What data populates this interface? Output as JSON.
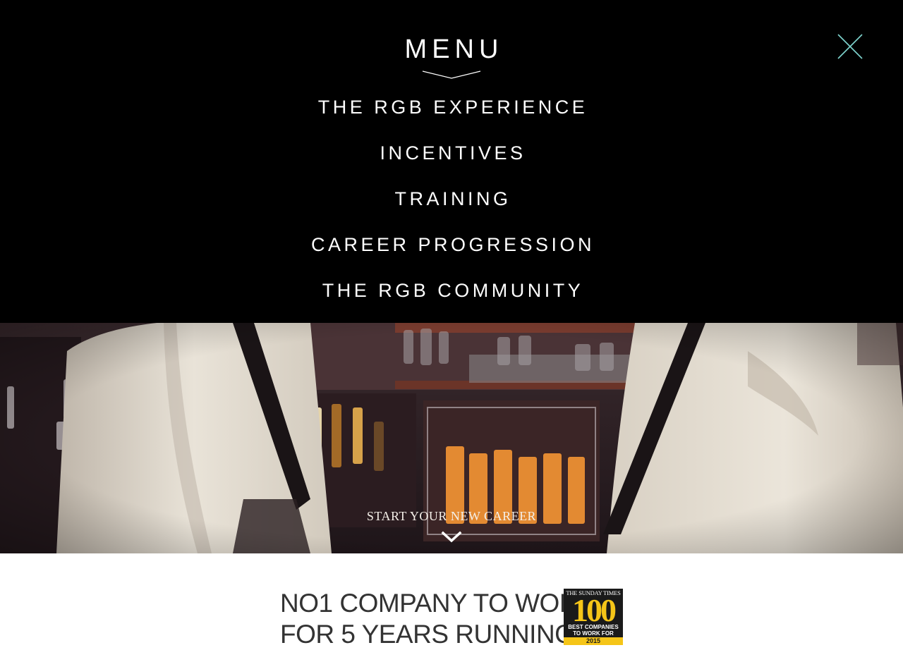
{
  "menu": {
    "title": "MENU",
    "items": [
      {
        "label": "THE RGB EXPERIENCE"
      },
      {
        "label": "INCENTIVES"
      },
      {
        "label": "TRAINING"
      },
      {
        "label": "CAREER PROGRESSION"
      },
      {
        "label": "THE RGB COMMUNITY"
      }
    ],
    "close_icon": "close-icon",
    "accent_color": "#7fd6d0"
  },
  "hero": {
    "cta_label": "START YOUR NEW CAREER",
    "cta_icon": "chevron-down-icon"
  },
  "award": {
    "heading_line1": "NO1 COMPANY TO WORK",
    "heading_line2": "FOR 5 YEARS RUNNING!",
    "badge": {
      "masthead": "THE SUNDAY TIMES",
      "number": "100",
      "caption_line1": "BEST COMPANIES",
      "caption_line2": "TO WORK FOR",
      "year": "2015",
      "accent_color": "#f5c518"
    }
  }
}
